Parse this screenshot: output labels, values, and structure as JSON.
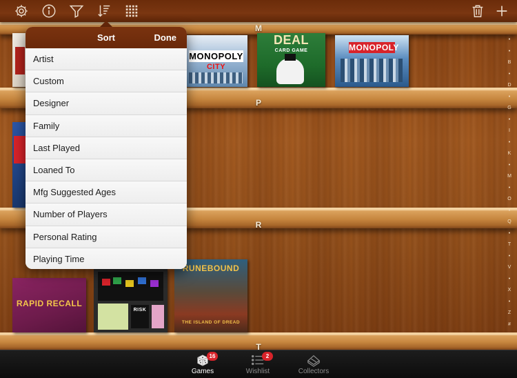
{
  "toolbar": {
    "left_icons": [
      "gear-icon",
      "info-icon",
      "filter-icon",
      "sort-icon",
      "grid-icon"
    ],
    "right_icons": [
      "trash-icon",
      "plus-icon"
    ]
  },
  "shelves": {
    "letters": [
      "M",
      "P",
      "R",
      "T"
    ]
  },
  "games": {
    "monopoly_city_title": "MONOPOLY",
    "monopoly_city_sub": "CITY",
    "deal_title": "DEAL",
    "deal_sub": "CARD GAME",
    "monopoly_here_title": "MONOPOLY",
    "rapid_recall_title": "RAPID RECALL",
    "runebound_title": "RUNEBOUND",
    "runebound_sub": "THE ISLAND OF DREAD",
    "risk_title": "RISK"
  },
  "index_strip": [
    "•",
    "•",
    "B",
    "•",
    "D",
    "•",
    "G",
    "•",
    "I",
    "•",
    "K",
    "•",
    "M",
    "•",
    "O",
    "•",
    "Q",
    "•",
    "T",
    "•",
    "V",
    "•",
    "X",
    "•",
    "Z",
    "#"
  ],
  "sort_popover": {
    "title": "Sort",
    "done_label": "Done",
    "items": [
      "Artist",
      "Custom",
      "Designer",
      "Family",
      "Last Played",
      "Loaned To",
      "Mfg Suggested Ages",
      "Number of Players",
      "Personal Rating",
      "Playing Time"
    ]
  },
  "tabbar": {
    "tabs": [
      {
        "label": "Games",
        "badge": "16"
      },
      {
        "label": "Wishlist",
        "badge": "2"
      },
      {
        "label": "Collectors",
        "badge": ""
      }
    ]
  }
}
